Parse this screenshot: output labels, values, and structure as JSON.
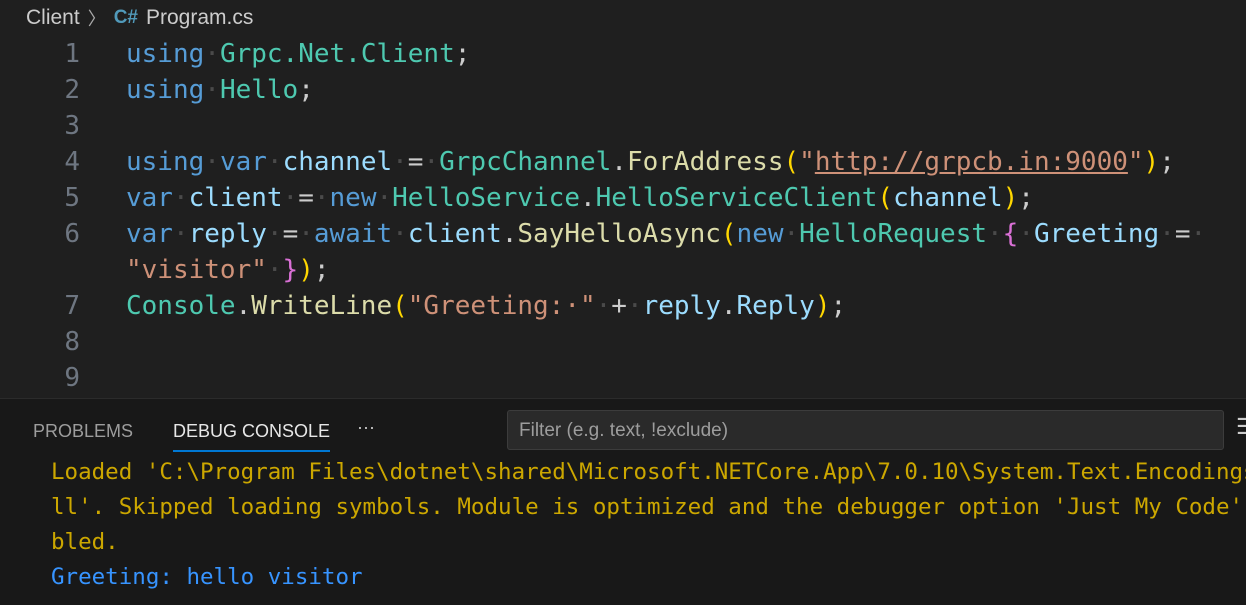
{
  "breadcrumb": {
    "folder": "Client",
    "file_icon": "C#",
    "file": "Program.cs"
  },
  "code": [
    {
      "n": "1",
      "t": [
        [
          "using",
          "kw"
        ],
        [
          "·",
          "ws"
        ],
        [
          "Grpc.Net.Client",
          "ty"
        ],
        [
          ";",
          "pu"
        ]
      ]
    },
    {
      "n": "2",
      "t": [
        [
          "using",
          "kw"
        ],
        [
          "·",
          "ws"
        ],
        [
          "Hello",
          "ty"
        ],
        [
          ";",
          "pu"
        ]
      ]
    },
    {
      "n": "3",
      "t": []
    },
    {
      "n": "4",
      "t": [
        [
          "using",
          "kw"
        ],
        [
          "·",
          "ws"
        ],
        [
          "var",
          "kw"
        ],
        [
          "·",
          "ws"
        ],
        [
          "channel",
          "va"
        ],
        [
          "·",
          "ws"
        ],
        [
          "=",
          "pu"
        ],
        [
          "·",
          "ws"
        ],
        [
          "GrpcChannel",
          "ty"
        ],
        [
          ".",
          "pu"
        ],
        [
          "ForAddress",
          "fn"
        ],
        [
          "(",
          "b1"
        ],
        [
          "\"",
          "st"
        ],
        [
          "http://grpcb.in:9000",
          "url"
        ],
        [
          "\"",
          "st"
        ],
        [
          ")",
          "b1"
        ],
        [
          ";",
          "pu"
        ]
      ]
    },
    {
      "n": "5",
      "t": [
        [
          "var",
          "kw"
        ],
        [
          "·",
          "ws"
        ],
        [
          "client",
          "va"
        ],
        [
          "·",
          "ws"
        ],
        [
          "=",
          "pu"
        ],
        [
          "·",
          "ws"
        ],
        [
          "new",
          "kw"
        ],
        [
          "·",
          "ws"
        ],
        [
          "HelloService",
          "ty"
        ],
        [
          ".",
          "pu"
        ],
        [
          "HelloServiceClient",
          "ty"
        ],
        [
          "(",
          "b1"
        ],
        [
          "channel",
          "va"
        ],
        [
          ")",
          "b1"
        ],
        [
          ";",
          "pu"
        ]
      ]
    },
    {
      "n": "6",
      "t": [
        [
          "var",
          "kw"
        ],
        [
          "·",
          "ws"
        ],
        [
          "reply",
          "va"
        ],
        [
          "·",
          "ws"
        ],
        [
          "=",
          "pu"
        ],
        [
          "·",
          "ws"
        ],
        [
          "await",
          "kw"
        ],
        [
          "·",
          "ws"
        ],
        [
          "client",
          "va"
        ],
        [
          ".",
          "pu"
        ],
        [
          "SayHelloAsync",
          "fn"
        ],
        [
          "(",
          "b1"
        ],
        [
          "new",
          "kw"
        ],
        [
          "·",
          "ws"
        ],
        [
          "HelloRequest",
          "ty"
        ],
        [
          "·",
          "ws"
        ],
        [
          "{",
          "b2"
        ],
        [
          "·",
          "ws"
        ],
        [
          "Greeting",
          "va"
        ],
        [
          "·",
          "ws"
        ],
        [
          "=",
          "pu"
        ],
        [
          "·",
          "ws"
        ]
      ]
    },
    {
      "n": "",
      "t": [
        [
          "\"visitor\"",
          "st"
        ],
        [
          "·",
          "ws"
        ],
        [
          "}",
          "b2"
        ],
        [
          ")",
          "b1"
        ],
        [
          ";",
          "pu"
        ]
      ]
    },
    {
      "n": "7",
      "t": [
        [
          "Console",
          "ty"
        ],
        [
          ".",
          "pu"
        ],
        [
          "WriteLine",
          "fn"
        ],
        [
          "(",
          "b1"
        ],
        [
          "\"Greeting:·\"",
          "st"
        ],
        [
          "·",
          "ws"
        ],
        [
          "+",
          "pu"
        ],
        [
          "·",
          "ws"
        ],
        [
          "reply",
          "va"
        ],
        [
          ".",
          "pu"
        ],
        [
          "Reply",
          "va"
        ],
        [
          ")",
          "b1"
        ],
        [
          ";",
          "pu"
        ]
      ]
    },
    {
      "n": "8",
      "t": []
    },
    {
      "n": "9",
      "t": []
    }
  ],
  "panel": {
    "tabs": [
      "PROBLEMS",
      "DEBUG CONSOLE"
    ],
    "more": "···",
    "filter_placeholder": "Filter (e.g. text, !exclude)",
    "menu_icon": "☰",
    "console": [
      {
        "text": "Loaded 'C:\\Program Files\\dotnet\\shared\\Microsoft.NETCore.App\\7.0.10\\System.Text.Encodings.Web.dll'. Skipped loading symbols. Module is optimized and the debugger option 'Just My Code' is enabled.",
        "kind": "warn"
      },
      {
        "text": "Greeting: hello visitor",
        "kind": "info"
      }
    ]
  }
}
